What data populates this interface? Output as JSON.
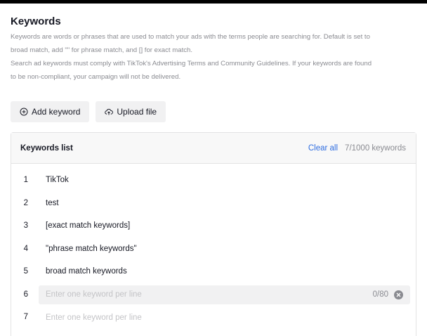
{
  "section": {
    "title": "Keywords",
    "desc_line1": "Keywords are words or phrases that are used to match your ads with the terms people are searching for. Default is set to",
    "desc_line2": "broad match, add \"\" for phrase match, and [] for exact match.",
    "desc_line3": "Search ad keywords must comply with TikTok's Advertising Terms and Community Guidelines. If your keywords are found",
    "desc_line4": "to be non-compliant, your campaign will not be delivered."
  },
  "actions": {
    "add_keyword": "Add keyword",
    "add_keyword_icon": "plus-circle-icon",
    "upload_file": "Upload file",
    "upload_file_icon": "upload-cloud-icon"
  },
  "keywords_panel": {
    "title": "Keywords list",
    "clear_all": "Clear all",
    "count": "7/1000 keywords",
    "rows": [
      {
        "num": "1",
        "text": "TikTok"
      },
      {
        "num": "2",
        "text": "test"
      },
      {
        "num": "3",
        "text": "[exact match keywords]"
      },
      {
        "num": "4",
        "text": "\"phrase match keywords\""
      },
      {
        "num": "5",
        "text": "broad match keywords"
      }
    ],
    "input_rows": [
      {
        "num": "6",
        "placeholder": "Enter one keyword per line",
        "counter": "0/80",
        "active": true
      },
      {
        "num": "7",
        "placeholder": "Enter one keyword per line",
        "active": false
      }
    ]
  },
  "colors": {
    "accent": "#2f6de0",
    "muted": "#8a8b91",
    "field_bg": "#f1f1f2"
  }
}
